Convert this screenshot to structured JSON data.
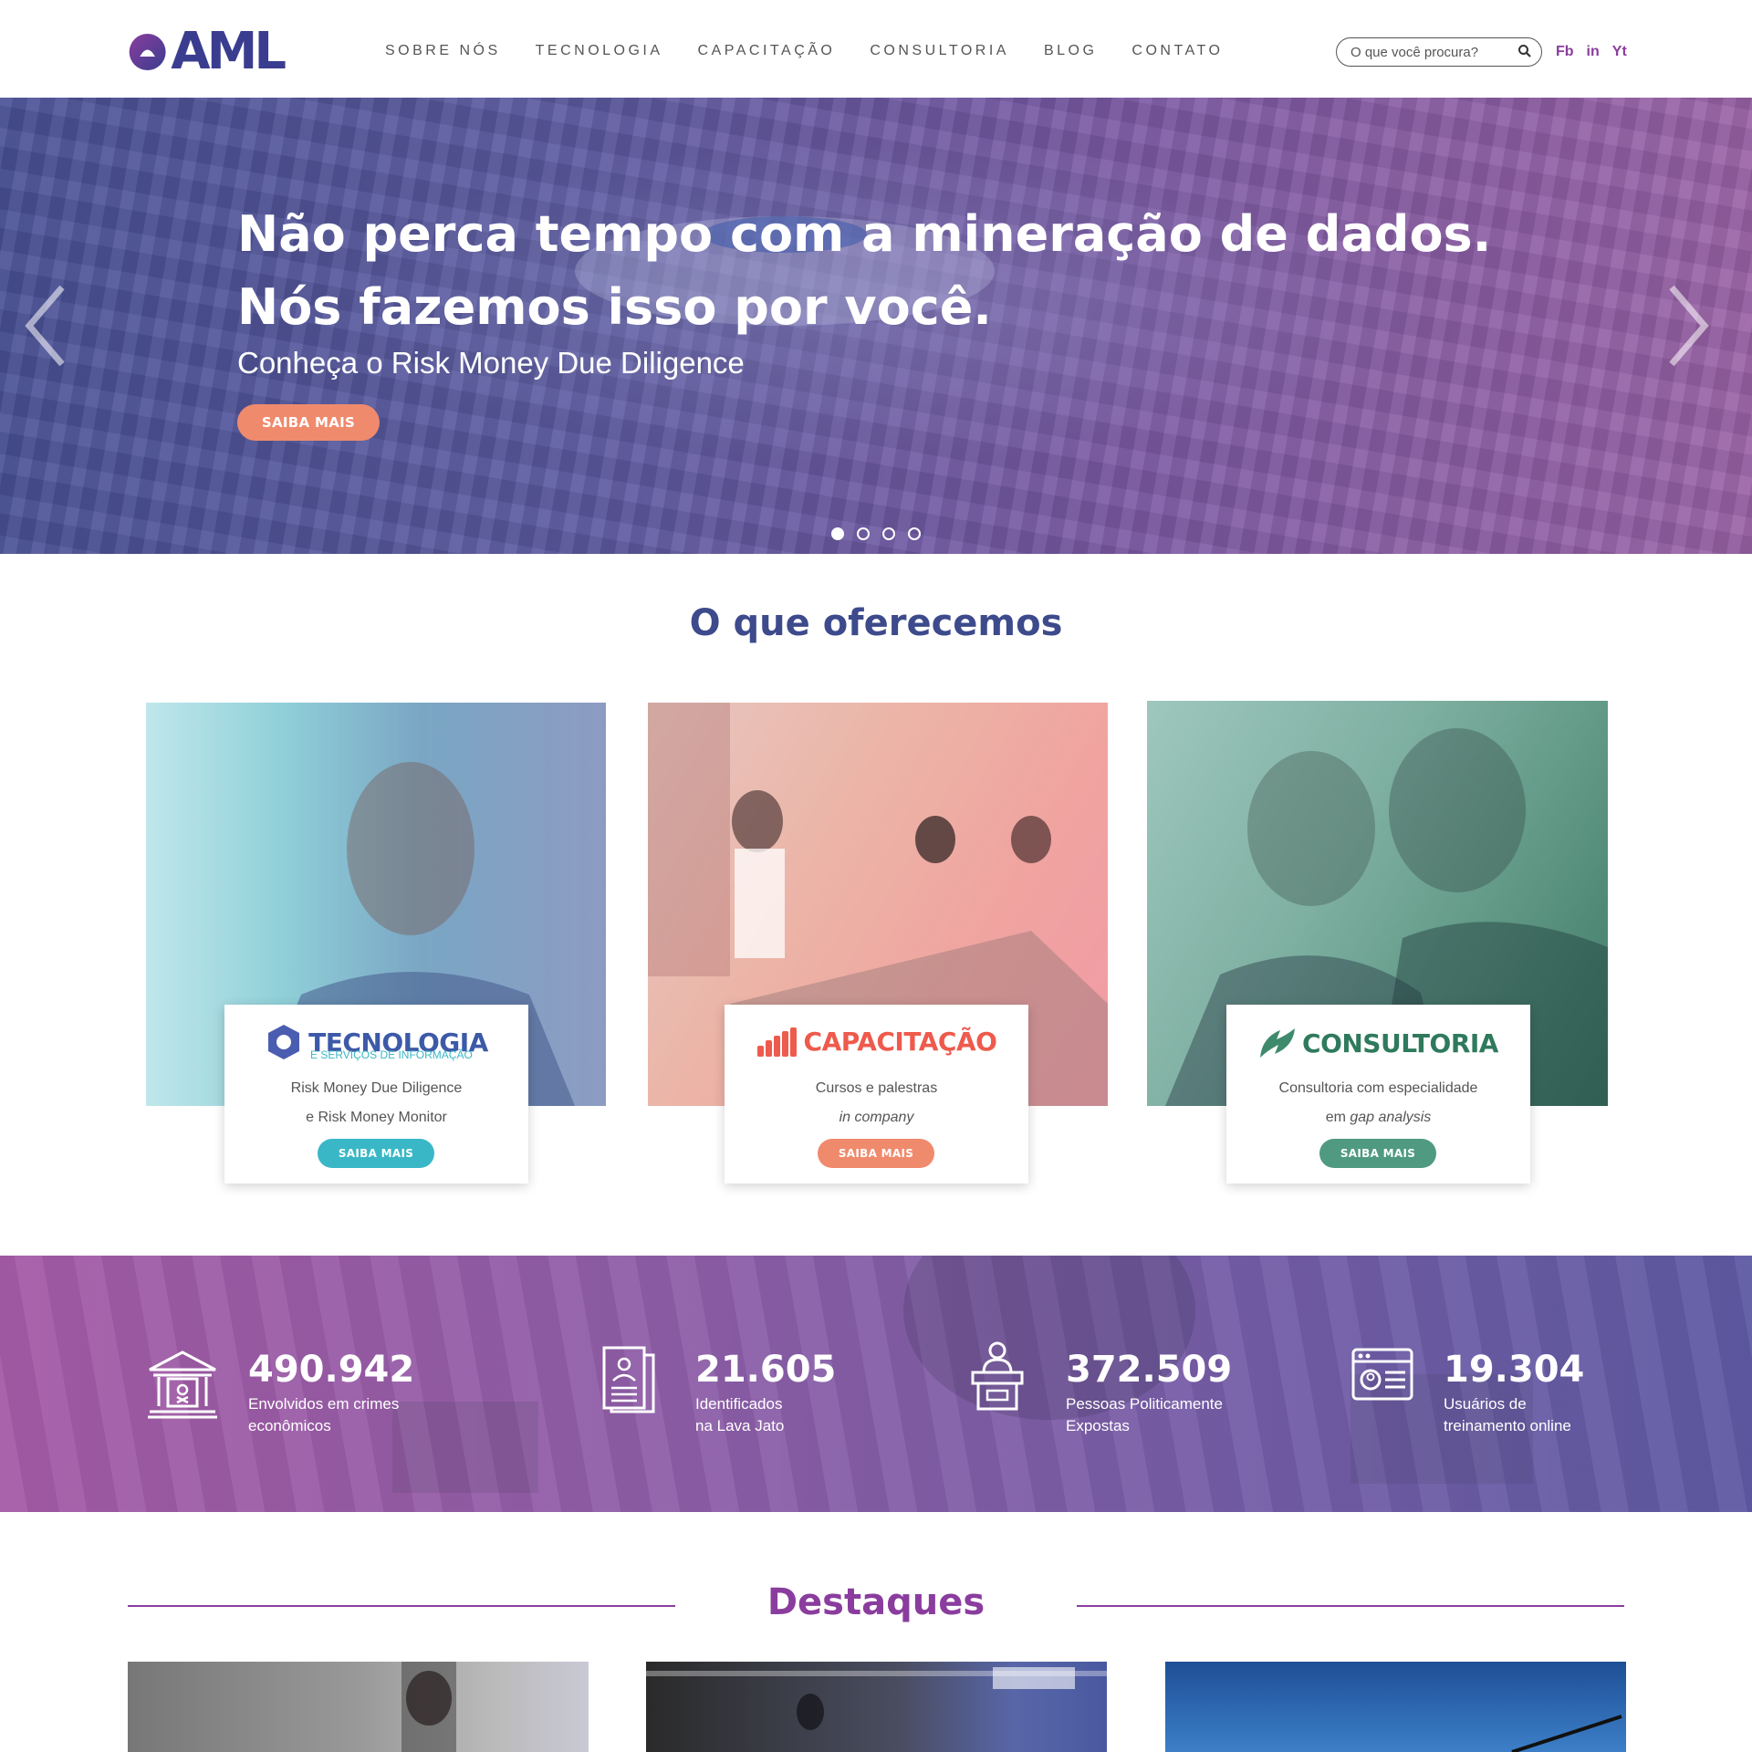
{
  "header": {
    "logo_text": "AML",
    "nav": [
      "SOBRE NÓS",
      "TECNOLOGIA",
      "CAPACITAÇÃO",
      "CONSULTORIA",
      "BLOG",
      "CONTATO"
    ],
    "search_placeholder": "O que você procura?",
    "social": [
      "Fb",
      "in",
      "Yt"
    ]
  },
  "hero": {
    "title_line1": "Não perca tempo com a mineração de dados.",
    "title_line2": "Nós fazemos isso por você.",
    "subtitle": "Conheça o Risk Money Due Diligence",
    "button": "SAIBA MAIS",
    "slides_total": 4,
    "active_slide": 1
  },
  "offer": {
    "title": "O que oferecemos",
    "cards": [
      {
        "brand": "TECNOLOGIA",
        "brand_sub": "E SERVIÇOS DE INFORMAÇÃO",
        "line1": "Risk Money Due Diligence",
        "line2": "e Risk Money Monitor",
        "button": "SAIBA MAIS",
        "color": "#3ab7c6"
      },
      {
        "brand": "CAPACITAÇÃO",
        "line1": "Cursos e palestras",
        "line2": "in company",
        "button": "SAIBA MAIS",
        "color": "#f08a6c"
      },
      {
        "brand": "CONSULTORIA",
        "line1": "Consultoria com especialidade",
        "line2_prefix": "em ",
        "line2_italic": "gap analysis",
        "button": "SAIBA MAIS",
        "color": "#4f9a80"
      }
    ]
  },
  "stats": [
    {
      "value": "490.942",
      "label1": "Envolvidos em crimes",
      "label2": "econômicos",
      "icon": "bank-icon"
    },
    {
      "value": "21.605",
      "label1": "Identificados",
      "label2": "na Lava Jato",
      "icon": "document-id-icon"
    },
    {
      "value": "372.509",
      "label1": "Pessoas Politicamente",
      "label2": "Expostas",
      "icon": "podium-icon"
    },
    {
      "value": "19.304",
      "label1": "Usuários de",
      "label2": "treinamento online",
      "icon": "id-card-icon"
    }
  ],
  "highlights": {
    "title": "Destaques"
  }
}
